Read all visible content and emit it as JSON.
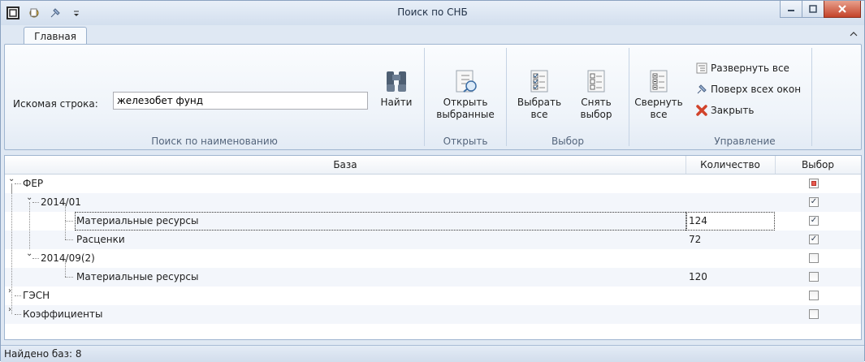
{
  "window": {
    "title": "Поиск по СНБ"
  },
  "tabs": [
    {
      "label": "Главная"
    }
  ],
  "ribbon": {
    "search": {
      "label": "Искомая строка:",
      "value": "железобет фунд",
      "button": "Найти",
      "group_label": "Поиск по наименованию"
    },
    "open": {
      "button_line1": "Открыть",
      "button_line2": "выбранные",
      "group_label": "Открыть"
    },
    "select": {
      "select_all_line1": "Выбрать",
      "select_all_line2": "все",
      "deselect_line1": "Снять",
      "deselect_line2": "выбор",
      "group_label": "Выбор"
    },
    "manage": {
      "collapse_line1": "Свернуть",
      "collapse_line2": "все",
      "expand_all": "Развернуть все",
      "on_top": "Поверх всех окон",
      "close": "Закрыть",
      "group_label": "Управление"
    }
  },
  "grid": {
    "columns": [
      "База",
      "Количество",
      "Выбор"
    ],
    "rows": [
      {
        "name": "ФЕР",
        "qty": "",
        "check": "partial"
      },
      {
        "name": "2014/01",
        "qty": "",
        "check": "checked"
      },
      {
        "name": "Материальные ресурсы",
        "qty": "124",
        "check": "checked"
      },
      {
        "name": "Расценки",
        "qty": "72",
        "check": "checked"
      },
      {
        "name": "2014/09(2)",
        "qty": "",
        "check": "unchecked"
      },
      {
        "name": "Материальные ресурсы",
        "qty": "120",
        "check": "unchecked"
      },
      {
        "name": "ГЭСН",
        "qty": "",
        "check": "unchecked"
      },
      {
        "name": "Коэффициенты",
        "qty": "",
        "check": "unchecked"
      }
    ]
  },
  "status": {
    "text": "Найдено баз: 8"
  },
  "colors": {
    "accent": "#dfe8f3",
    "close_button": "#c4432a",
    "partial_check": "#e85a4f"
  }
}
